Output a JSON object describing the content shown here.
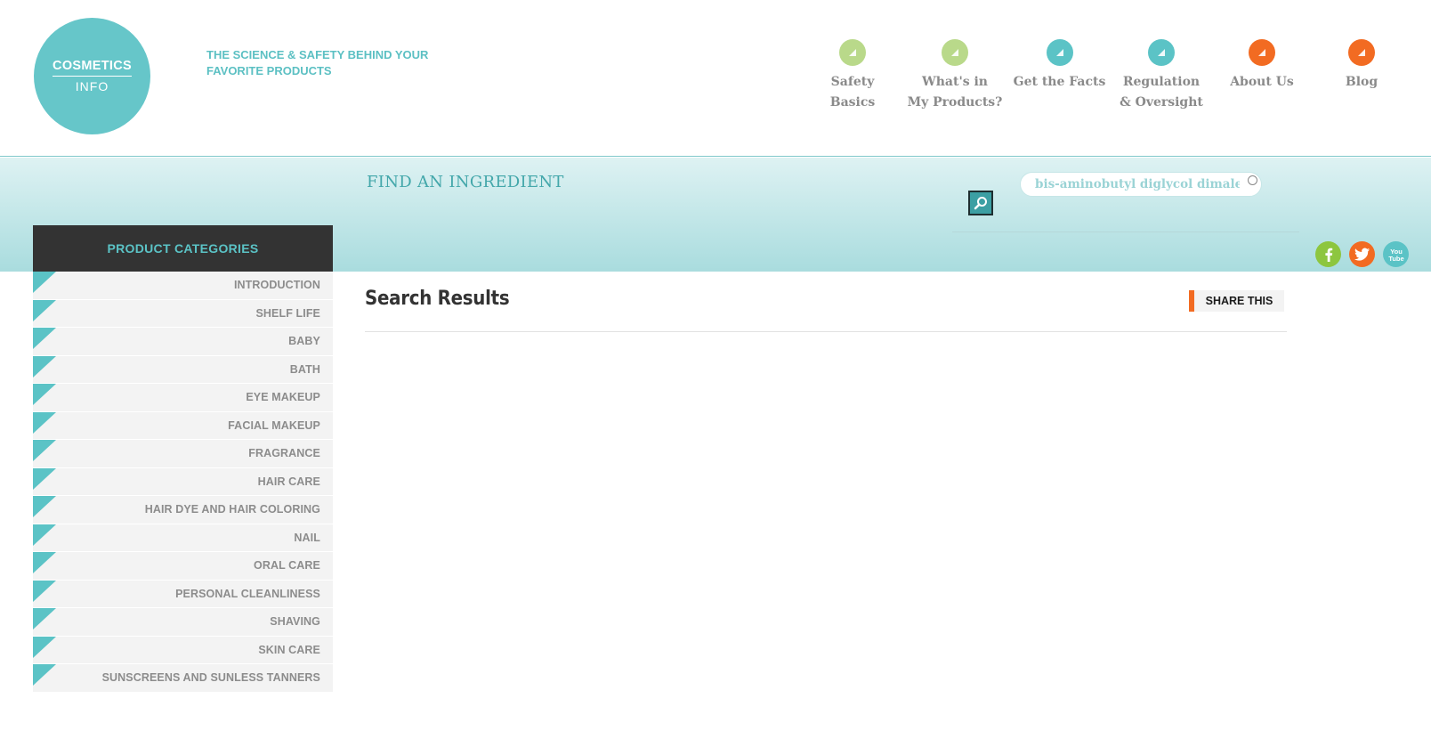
{
  "site": {
    "logo_line1": "COSMETICS",
    "logo_line2": "INFO",
    "tagline": "THE SCIENCE & SAFETY BEHIND YOUR FAVORITE PRODUCTS"
  },
  "nav": [
    {
      "label": "Safety Basics",
      "color": "#b9d98a"
    },
    {
      "label": "What's in\nMy Products?",
      "color": "#b9d98a"
    },
    {
      "label": "Get the Facts",
      "color": "#5bc3c6"
    },
    {
      "label": "Regulation\n& Oversight",
      "color": "#5bc3c6"
    },
    {
      "label": "About Us",
      "color": "#f26b22"
    },
    {
      "label": "Blog",
      "color": "#f26b22"
    }
  ],
  "search": {
    "title": "FIND AN INGREDIENT",
    "value": "bis-aminobutyl diglycol dimaleate",
    "button_icon": "magnifier-icon"
  },
  "social": [
    {
      "name": "facebook",
      "glyph": "f",
      "color": "#8dc63f"
    },
    {
      "name": "twitter",
      "glyph": "t",
      "color": "#f26b22"
    },
    {
      "name": "youtube",
      "glyph": "You\nTube",
      "color": "#5bc3c6"
    }
  ],
  "sidebar": {
    "title": "PRODUCT CATEGORIES",
    "items": [
      "INTRODUCTION",
      "SHELF LIFE",
      "BABY",
      "BATH",
      "EYE MAKEUP",
      "FACIAL MAKEUP",
      "FRAGRANCE",
      "HAIR CARE",
      "HAIR DYE AND HAIR COLORING",
      "NAIL",
      "ORAL CARE",
      "PERSONAL CLEANLINESS",
      "SHAVING",
      "SKIN CARE",
      "SUNSCREENS AND SUNLESS TANNERS"
    ]
  },
  "main": {
    "title": "Search Results",
    "share_label": "SHARE THIS"
  },
  "colors": {
    "teal": "#5bc3c6",
    "green": "#b9d98a",
    "orange": "#f26b22",
    "dark": "#333333"
  }
}
